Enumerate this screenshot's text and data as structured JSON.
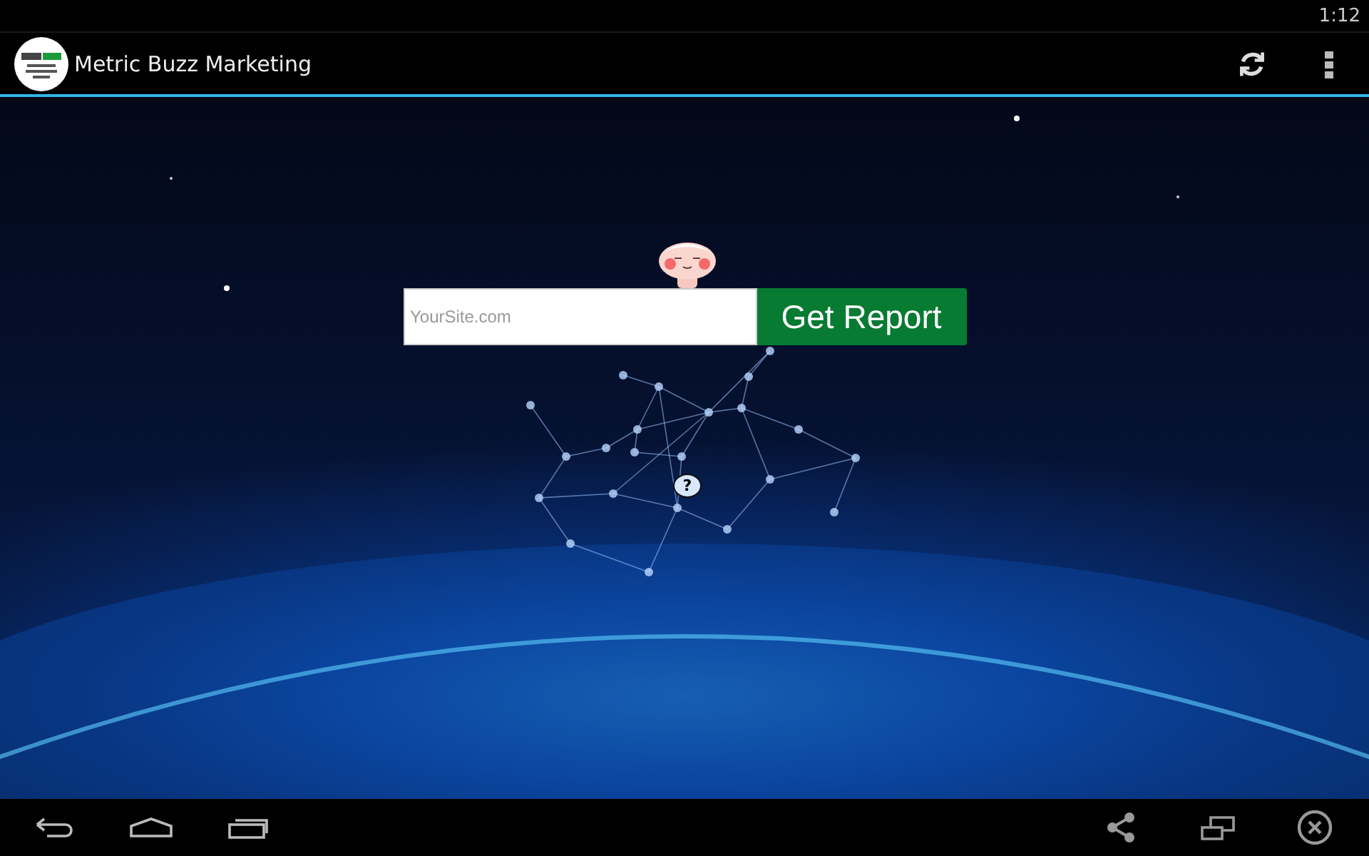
{
  "status_bar": {
    "time": "1:12"
  },
  "action_bar": {
    "title": "Metric Buzz Marketing"
  },
  "form": {
    "placeholder": "YourSite.com",
    "button": "Get Report"
  },
  "help_bubble": {
    "label": "?"
  }
}
